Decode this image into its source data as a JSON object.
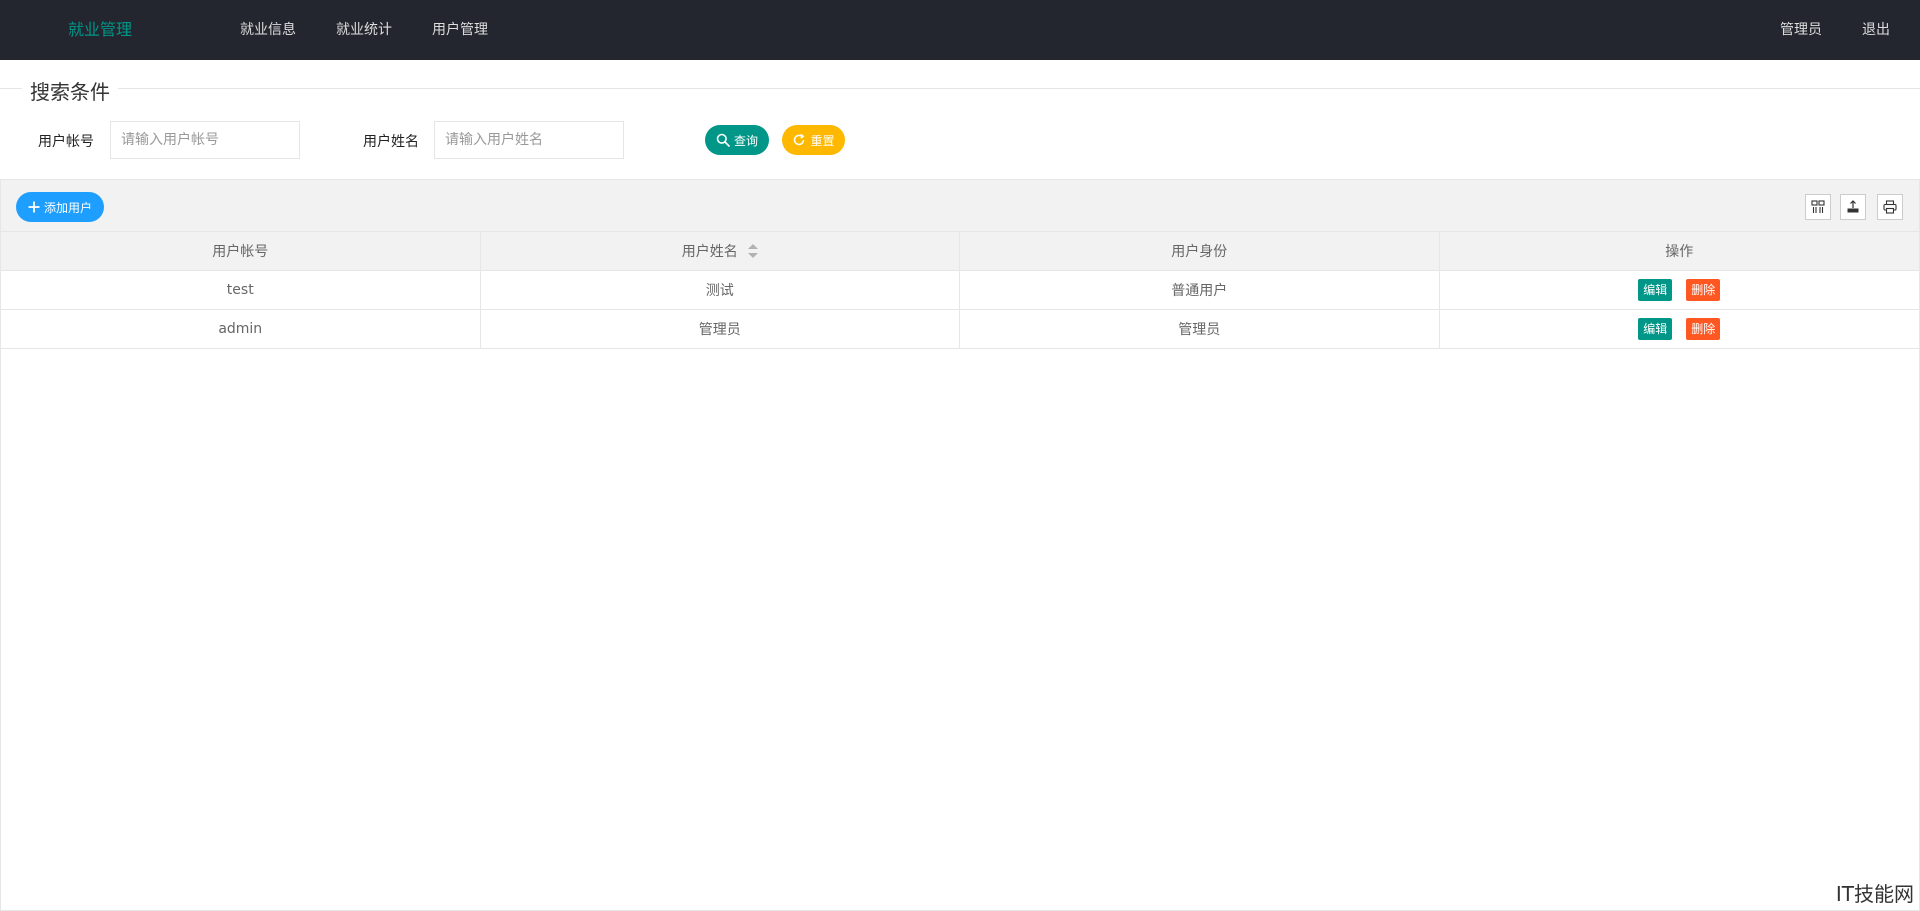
{
  "header": {
    "logo": "就业管理",
    "nav": [
      "就业信息",
      "就业统计",
      "用户管理"
    ],
    "user": "管理员",
    "logout": "退出"
  },
  "search": {
    "legend": "搜索条件",
    "account_label": "用户帐号",
    "account_placeholder": "请输入用户帐号",
    "name_label": "用户姓名",
    "name_placeholder": "请输入用户姓名",
    "query_label": "查询",
    "reset_label": "重置"
  },
  "toolbar": {
    "add_label": "添加用户",
    "icons": [
      "columns-icon",
      "export-icon",
      "print-icon"
    ]
  },
  "table": {
    "columns": [
      "用户帐号",
      "用户姓名",
      "用户身份",
      "操作"
    ],
    "rows": [
      {
        "account": "test",
        "name": "测试",
        "role": "普通用户",
        "edit": "编辑",
        "delete": "删除"
      },
      {
        "account": "admin",
        "name": "管理员",
        "role": "管理员",
        "edit": "编辑",
        "delete": "删除"
      }
    ]
  },
  "watermark": "IT技能网",
  "colors": {
    "header_bg": "#23262e",
    "primary": "#009688",
    "warm": "#ffb800",
    "blue": "#1e9fff",
    "danger": "#ff5722"
  }
}
